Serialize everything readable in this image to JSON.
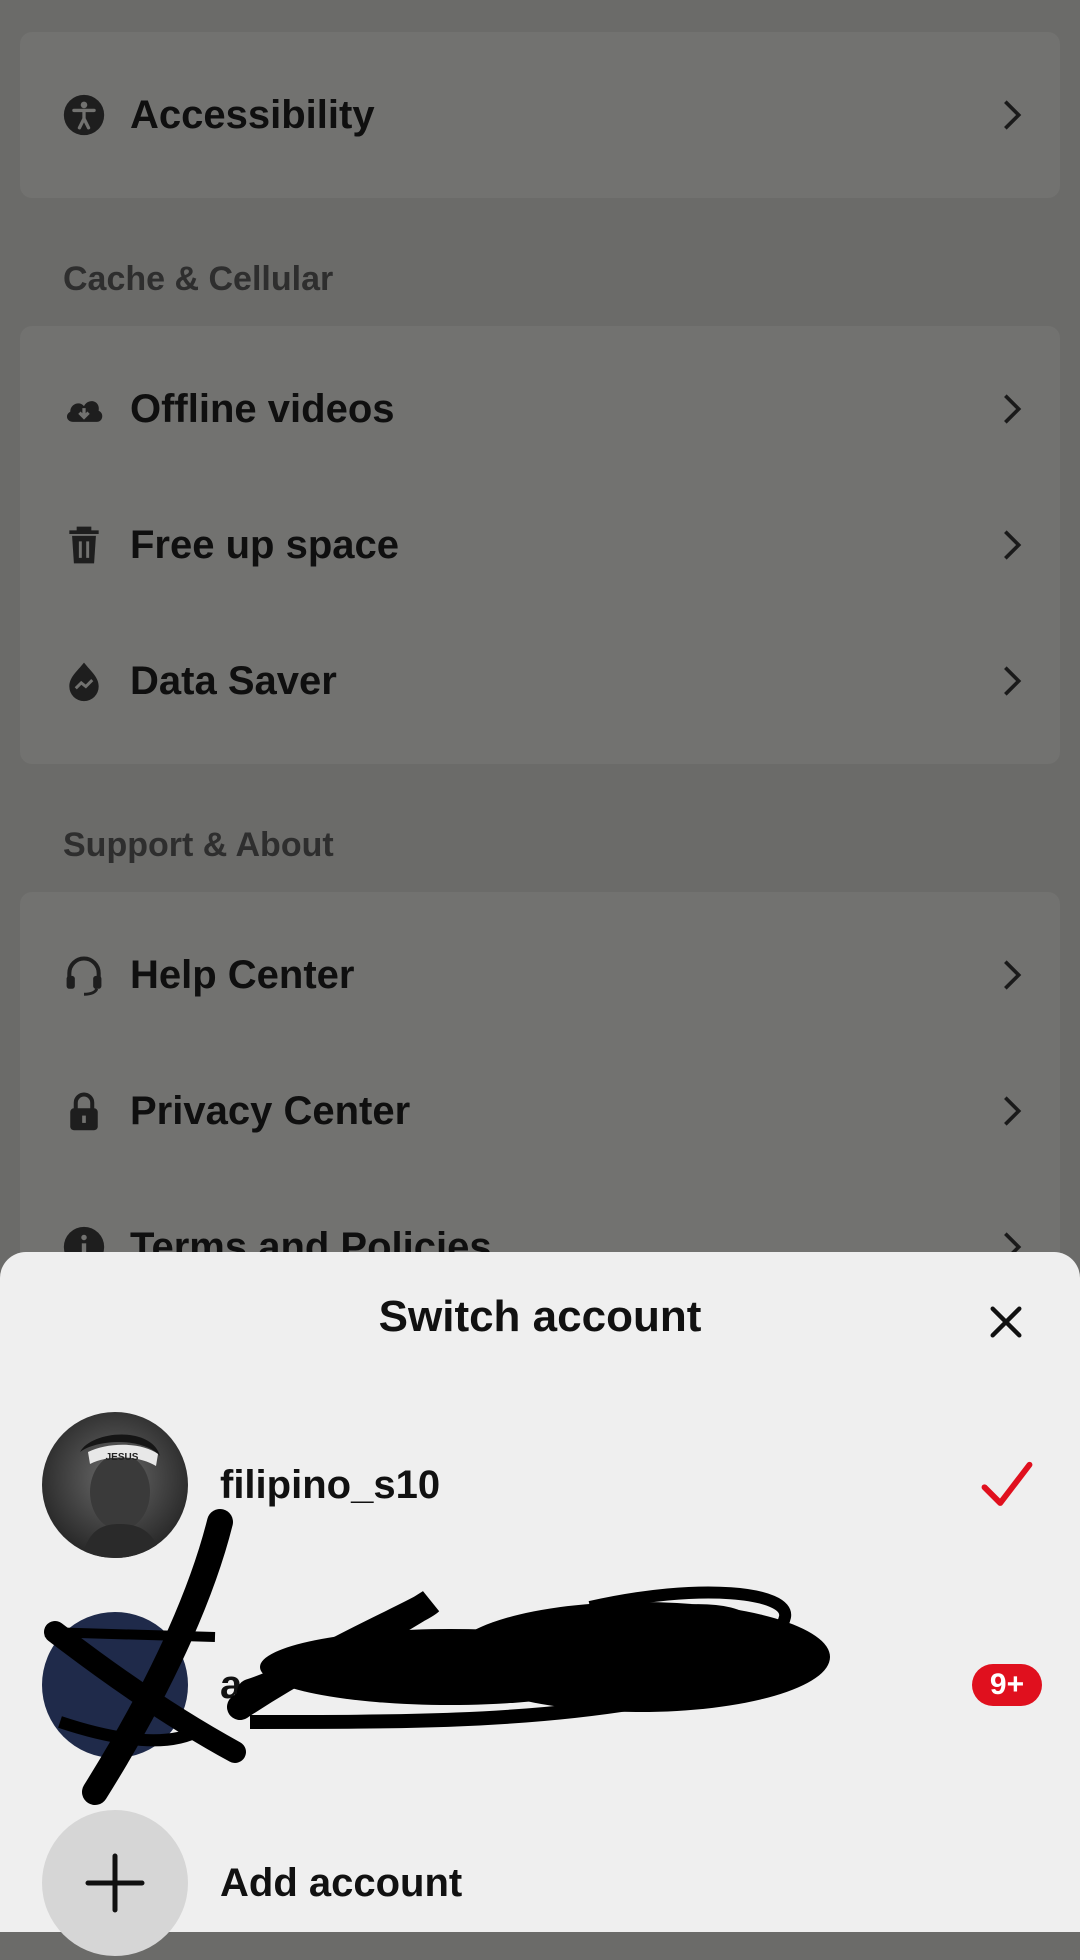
{
  "settings": {
    "rows_top": [
      {
        "label": "Accessibility",
        "icon": "accessibility-icon"
      }
    ],
    "sections": [
      {
        "title": "Cache & Cellular",
        "items": [
          {
            "label": "Offline videos",
            "icon": "cloud-download-icon"
          },
          {
            "label": "Free up space",
            "icon": "trash-icon"
          },
          {
            "label": "Data Saver",
            "icon": "data-saver-icon"
          }
        ]
      },
      {
        "title": "Support & About",
        "items": [
          {
            "label": "Help Center",
            "icon": "headset-icon"
          },
          {
            "label": "Privacy Center",
            "icon": "lock-icon"
          },
          {
            "label": "Terms and Policies",
            "icon": "info-icon"
          }
        ]
      }
    ]
  },
  "sheet": {
    "title": "Switch account",
    "close_icon": "close-icon",
    "accounts": [
      {
        "username": "filipino_s10",
        "selected": true,
        "avatar_text": "JESUS"
      },
      {
        "username": "a",
        "selected": false,
        "badge": "9+"
      }
    ],
    "add_account_label": "Add account"
  },
  "colors": {
    "dim_background": "#6b6b69",
    "sheet_background": "#efefef",
    "accent_red": "#e0101e"
  }
}
